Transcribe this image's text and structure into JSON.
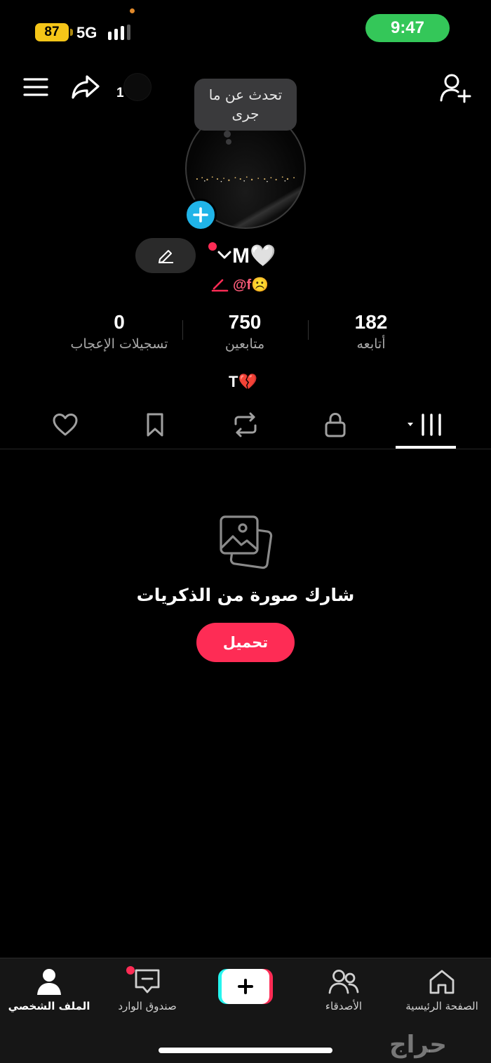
{
  "status_bar": {
    "battery": "87",
    "network": "5G",
    "time": "9:47"
  },
  "header": {
    "share_count": "1"
  },
  "profile": {
    "bubble_text": "تحدث عن ما جرى",
    "name": "M🤍",
    "username": "@f☹️",
    "bio": "T💔"
  },
  "stats": {
    "following": {
      "value": "182",
      "label": "أتابعه"
    },
    "followers": {
      "value": "750",
      "label": "متابعين"
    },
    "likes": {
      "value": "0",
      "label": "تسجيلات الإعجاب"
    }
  },
  "tabs": [
    "videos-grid",
    "private",
    "reposts",
    "saved",
    "liked"
  ],
  "empty_state": {
    "title": "شارك صورة من الذكريات",
    "button": "تحميل"
  },
  "bottom_nav": {
    "home": "الصفحة الرئيسية",
    "friends": "الأصدقاء",
    "inbox": "صندوق الوارد",
    "profile": "الملف الشخصي"
  },
  "watermark": "حراج",
  "colors": {
    "accent": "#fe2c55",
    "avatar_add": "#20b4e8",
    "time_pill": "#34c759",
    "battery": "#f5c518"
  }
}
